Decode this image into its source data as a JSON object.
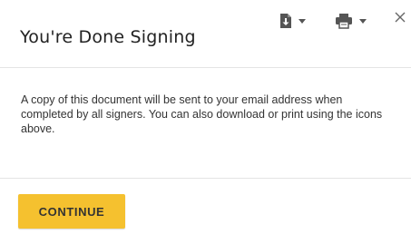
{
  "dialog": {
    "title": "You're Done Signing",
    "message": "A copy of this document will be sent to your email address when completed by all signers. You can also download or print using the icons above.",
    "continue_label": "CONTINUE"
  },
  "toolbar": {
    "download_icon": "download-icon",
    "print_icon": "print-icon",
    "close_icon": "close-icon"
  },
  "colors": {
    "accent": "#f5c12f",
    "icon": "#555555",
    "divider": "#e4e4e4"
  }
}
